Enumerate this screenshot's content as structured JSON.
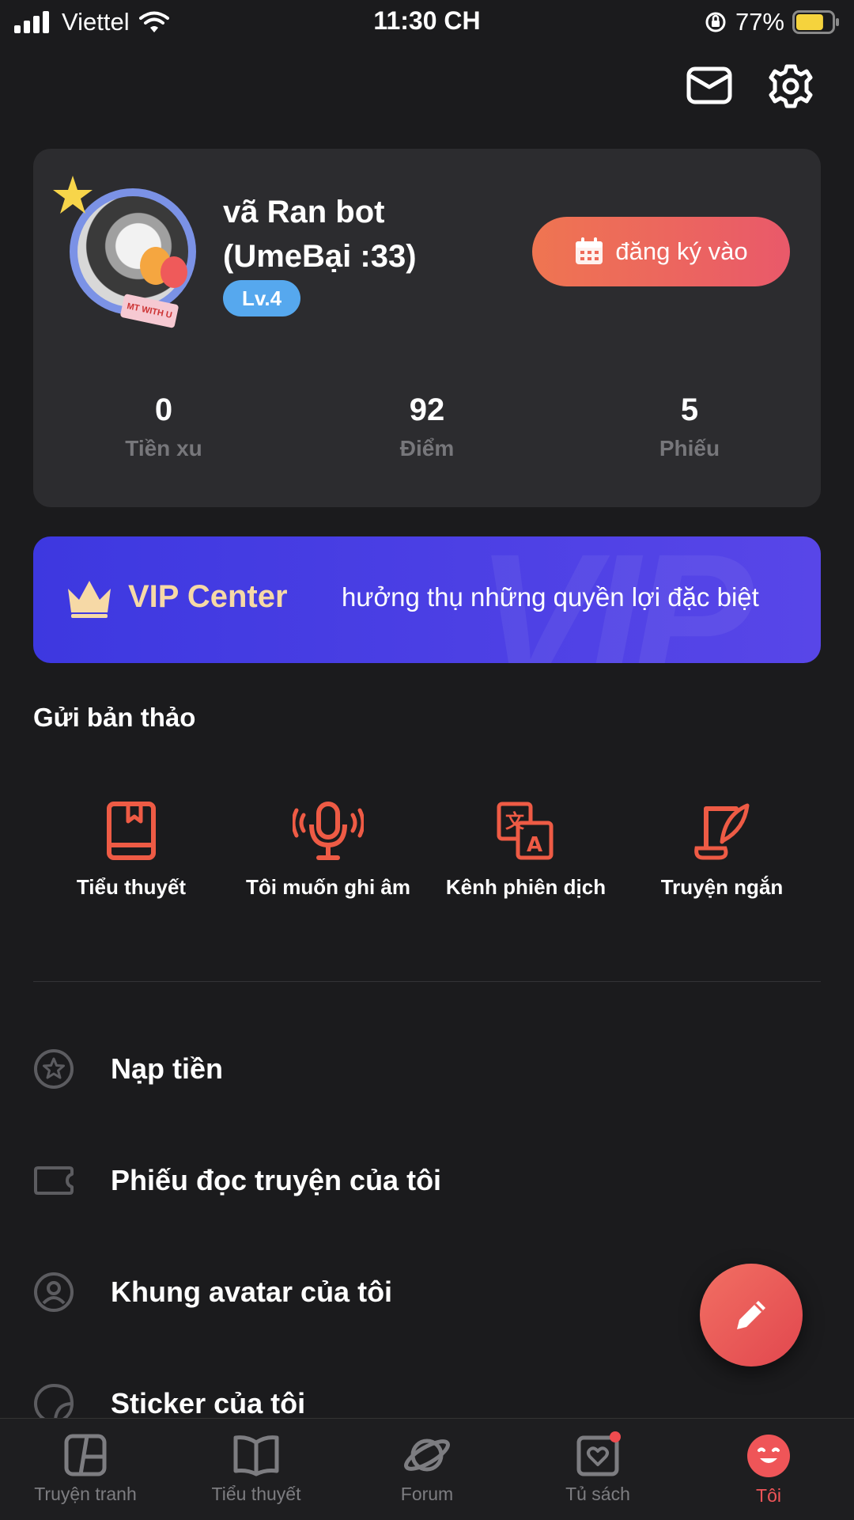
{
  "status_bar": {
    "carrier": "Viettel",
    "time": "11:30 CH",
    "battery_percent": "77%",
    "battery_level": 0.77
  },
  "profile": {
    "name": "vã Ran bot (UmeBại :33)",
    "level": "Lv.4",
    "avatar_sticker_text": "MT WITH U",
    "checkin_label": "đăng ký vào",
    "stats": [
      {
        "value": "0",
        "label": "Tiền xu"
      },
      {
        "value": "92",
        "label": "Điểm"
      },
      {
        "value": "5",
        "label": "Phiếu"
      }
    ]
  },
  "vip": {
    "title": "VIP Center",
    "description": "hưởng thụ những quyền lợi đặc biệt",
    "watermark": "VIP"
  },
  "submit_section": {
    "title": "Gửi bản thảo",
    "items": [
      {
        "label": "Tiểu thuyết",
        "icon": "book-icon"
      },
      {
        "label": "Tôi muốn ghi âm",
        "icon": "microphone-icon"
      },
      {
        "label": "Kênh phiên dịch",
        "icon": "translate-icon"
      },
      {
        "label": "Truyện ngắn",
        "icon": "quill-icon"
      }
    ]
  },
  "menu": [
    {
      "label": "Nạp tiền",
      "icon": "star-coin-icon"
    },
    {
      "label": "Phiếu đọc truyện của tôi",
      "icon": "ticket-icon"
    },
    {
      "label": "Khung avatar của tôi",
      "icon": "avatar-frame-icon"
    },
    {
      "label": "Sticker của tôi",
      "icon": "sticker-icon"
    }
  ],
  "bottom_nav": [
    {
      "label": "Truyện tranh",
      "icon": "comic-icon"
    },
    {
      "label": "Tiểu thuyết",
      "icon": "open-book-icon"
    },
    {
      "label": "Forum",
      "icon": "planet-icon"
    },
    {
      "label": "Tủ sách",
      "icon": "bookshelf-heart-icon"
    },
    {
      "label": "Tôi",
      "icon": "smiley-icon",
      "active": true
    }
  ],
  "colors": {
    "accent": "#ef5558",
    "background": "#1b1b1d",
    "card": "#2c2c2f",
    "vip_gradient_start": "#3d38e0",
    "vip_gradient_end": "#5846e8",
    "level_badge": "#56a8ee"
  }
}
